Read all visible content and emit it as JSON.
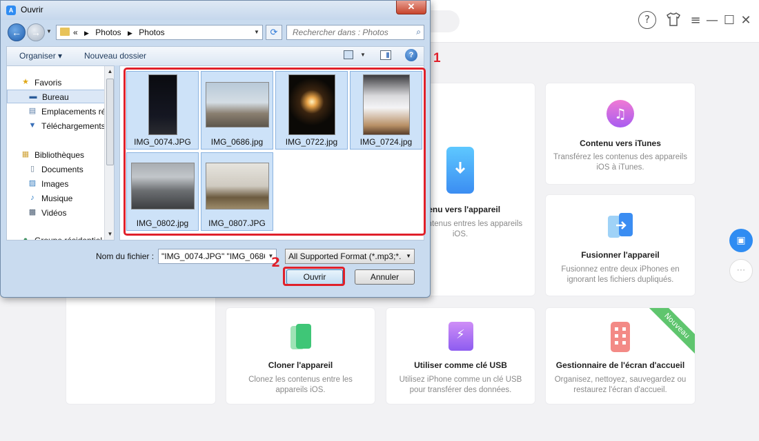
{
  "app": {
    "topbar": {
      "device_label": "",
      "help_icon": "?"
    },
    "cards": {
      "device_transfer": {
        "title": "ntenu vers l'appareil",
        "desc": "z des contenus entres les appareils iOS."
      },
      "itunes": {
        "title": "Contenu vers iTunes",
        "desc": "Transférez les contenus des appareils iOS à iTunes."
      },
      "merge": {
        "title": "Fusionner l'appareil",
        "desc": "Fusionnez entre deux iPhones en ignorant les fichiers dupliqués."
      },
      "clone": {
        "title": "Cloner l'appareil",
        "desc": "Clonez les contenus entre les appareils iOS."
      },
      "usb": {
        "title": "Utiliser comme clé USB",
        "desc": "Utilisez iPhone comme un clé USB pour transférer des données."
      },
      "homescreen": {
        "title": "Gestionnaire de l'écran d'accueil",
        "desc": "Organisez, nettoyez, sauvegardez ou restaurez l'écran d'accueil.",
        "badge": "Nouveau"
      }
    },
    "icons": {
      "toolbox": "toolbox-icon",
      "grid": "apps-grid-icon"
    }
  },
  "dialog": {
    "title": "Ouvrir",
    "address": {
      "prefix": "«",
      "path": [
        "Photos",
        "Photos"
      ]
    },
    "search_placeholder": "Rechercher dans : Photos",
    "commands": {
      "organize": "Organiser ▾",
      "new_folder": "Nouveau dossier"
    },
    "nav_items": [
      {
        "label": "Favoris",
        "icon": "★",
        "level": 0,
        "color": "#e0a817"
      },
      {
        "label": "Bureau",
        "icon": "▬",
        "level": 1,
        "color": "#2a5c9a",
        "selected": true
      },
      {
        "label": "Emplacements récents",
        "icon": "▤",
        "level": 1,
        "color": "#5a7ea8"
      },
      {
        "label": "Téléchargements",
        "icon": "▼",
        "level": 1,
        "color": "#3a70b8"
      },
      {
        "label": "Bibliothèques",
        "icon": "▦",
        "level": 0,
        "color": "#d1a43a"
      },
      {
        "label": "Documents",
        "icon": "▯",
        "level": 1,
        "color": "#6b7f95"
      },
      {
        "label": "Images",
        "icon": "▨",
        "level": 1,
        "color": "#3a7fc0"
      },
      {
        "label": "Musique",
        "icon": "♪",
        "level": 1,
        "color": "#2a7bc4"
      },
      {
        "label": "Vidéos",
        "icon": "▩",
        "level": 1,
        "color": "#4a5d73"
      },
      {
        "label": "Groupe résidentiel",
        "icon": "●",
        "level": 0,
        "color": "#3a8f5a"
      }
    ],
    "files": [
      {
        "name": "IMG_0074.JPG",
        "selected": true
      },
      {
        "name": "IMG_0686.jpg",
        "selected": true
      },
      {
        "name": "IMG_0722.jpg",
        "selected": true
      },
      {
        "name": "IMG_0724.jpg",
        "selected": true
      },
      {
        "name": "IMG_0802.jpg",
        "selected": true
      },
      {
        "name": "IMG_0807.JPG",
        "selected": true
      }
    ],
    "filename_label": "Nom du fichier :",
    "filename_value": "\"IMG_0074.JPG\" \"IMG_0686.j",
    "format_value": "All Supported Format (*.mp3;*.",
    "open_label": "Ouvrir",
    "cancel_label": "Annuler"
  },
  "annotations": {
    "step1": "1",
    "step2": "2",
    "highlight_color": "#e0202a"
  }
}
